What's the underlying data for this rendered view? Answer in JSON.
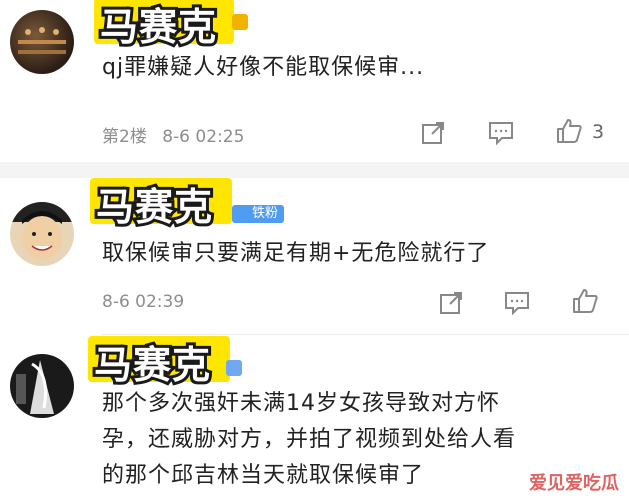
{
  "comments": [
    {
      "username": "马赛克",
      "text": "qj罪嫌疑人好像不能取保候审...",
      "floor": "第2楼",
      "date": "8-6 02:25",
      "likes": "3"
    },
    {
      "username": "马赛克",
      "fan_badge": "铁粉",
      "text": "取保候审只要满足有期+无危险就行了",
      "date": "8-6 02:39"
    },
    {
      "username": "马赛克",
      "text_lines": [
        "那个多次强奸未满14岁女孩导致对方怀",
        "孕，还威胁对方，并拍了视频到处给人看",
        "的那个邱吉林当天就取保候审了"
      ]
    }
  ],
  "watermark": "爱见爱吃瓜",
  "icons": [
    "share-icon",
    "comment-icon",
    "like-icon"
  ]
}
